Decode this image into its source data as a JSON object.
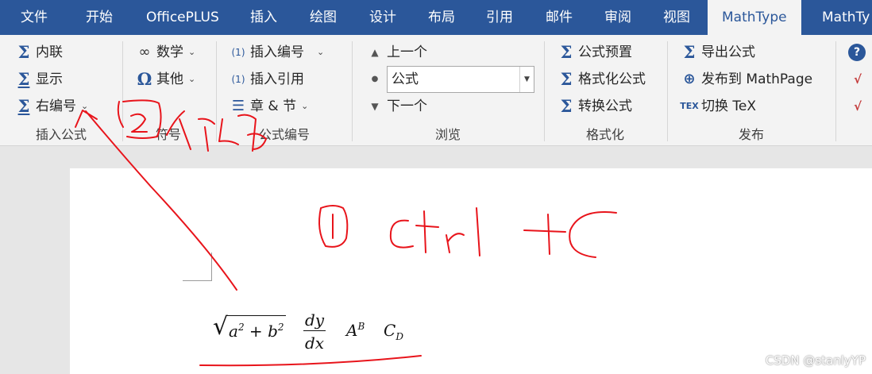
{
  "tabs": [
    {
      "label": "文件"
    },
    {
      "label": "开始"
    },
    {
      "label": "OfficePLUS"
    },
    {
      "label": "插入"
    },
    {
      "label": "绘图"
    },
    {
      "label": "设计"
    },
    {
      "label": "布局"
    },
    {
      "label": "引用"
    },
    {
      "label": "邮件"
    },
    {
      "label": "审阅"
    },
    {
      "label": "视图"
    },
    {
      "label": "MathType",
      "active": true
    },
    {
      "label": "MathTy"
    }
  ],
  "ribbon": {
    "insert_formula": {
      "label": "插入公式",
      "inline": "内联",
      "display": "显示",
      "right_number": "右编号"
    },
    "symbols": {
      "label": "符号",
      "math": "数学",
      "other": "其他"
    },
    "formula_number": {
      "label": "公式编号",
      "insert_number": "插入编号",
      "insert_reference": "插入引用",
      "chapter_section": "章 & 节",
      "number_glyph": "(1)"
    },
    "browse": {
      "label": "浏览",
      "prev": "上一个",
      "next": "下一个",
      "combo_value": "公式"
    },
    "format": {
      "label": "格式化",
      "preset": "公式预置",
      "format_formula": "格式化公式",
      "convert": "转换公式"
    },
    "publish": {
      "label": "发布",
      "export": "导出公式",
      "mathpage": "发布到 MathPage",
      "toggle_tex": "切换 TeX"
    }
  },
  "document": {
    "formulas": {
      "sqrt_a": "a",
      "sqrt_a_exp": "2",
      "sqrt_plus": " + ",
      "sqrt_b": "b",
      "sqrt_b_exp": "2",
      "frac_num": "dy",
      "frac_den": "dx",
      "power_base": "A",
      "power_exp": "B",
      "sub_base": "C",
      "sub_index": "D"
    }
  },
  "watermark": "CSDN @stanlyYP",
  "colors": {
    "tab_bar": "#2b579a",
    "ribbon": "#f3f3f3",
    "annotation_ink": "#e8141b"
  }
}
